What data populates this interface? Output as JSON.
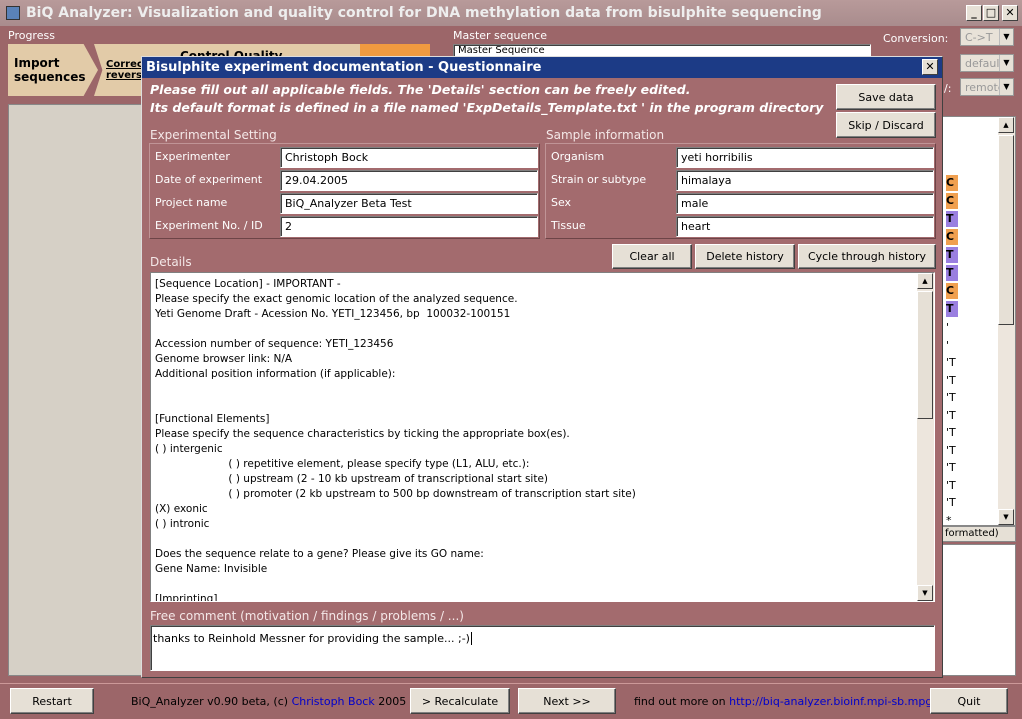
{
  "window": {
    "title": "BiQ Analyzer: Visualization and quality control for DNA methylation data from bisulphite sequencing"
  },
  "top": {
    "progress_label": "Progress",
    "steps": [
      "Import sequences",
      "Correct reverse",
      "Control Quality"
    ],
    "master_sequence_label": "Master sequence",
    "master_sequence_value": "Master Sequence",
    "conversion_label": "Conversion:",
    "conversion_value": "C->T",
    "option2_value": "default",
    "option3_label": "/:",
    "option3_value": "remote",
    "formatted_label": "formatted)"
  },
  "dialog": {
    "title": "Bisulphite experiment documentation - Questionnaire",
    "info_line1": "Please fill out all applicable fields. The 'Details' section can be freely edited.",
    "info_line2": "Its default format is defined in a file named 'ExpDetails_Template.txt ' in the program directory",
    "save_label": "Save data",
    "skip_label": "Skip / Discard",
    "experimental_setting": {
      "title": "Experimental Setting",
      "rows": [
        {
          "label": "Experimenter",
          "value": "Christoph Bock"
        },
        {
          "label": "Date of experiment",
          "value": "29.04.2005"
        },
        {
          "label": "Project name",
          "value": "BiQ_Analyzer Beta Test"
        },
        {
          "label": "Experiment No. / ID",
          "value": "2"
        }
      ]
    },
    "sample_information": {
      "title": "Sample information",
      "rows": [
        {
          "label": "Organism",
          "value": "yeti horribilis"
        },
        {
          "label": "Strain or subtype",
          "value": "himalaya"
        },
        {
          "label": "Sex",
          "value": "male"
        },
        {
          "label": "Tissue",
          "value": "heart"
        }
      ]
    },
    "details_label": "Details",
    "clear_all_label": "Clear all",
    "delete_history_label": "Delete history",
    "cycle_history_label": "Cycle through history",
    "details_text": "[Sequence Location] - IMPORTANT -\nPlease specify the exact genomic location of the analyzed sequence.\nYeti Genome Draft - Acession No. YETI_123456, bp  100032-100151\n\nAccession number of sequence: YETI_123456\nGenome browser link: N/A\nAdditional position information (if applicable):\n\n\n[Functional Elements]\nPlease specify the sequence characteristics by ticking the appropriate box(es).\n( ) intergenic\n                      ( ) repetitive element, please specify type (L1, ALU, etc.):\n                      ( ) upstream (2 - 10 kb upstream of transcriptional start site)\n                      ( ) promoter (2 kb upstream to 500 bp downstream of transcription start site)\n(X) exonic\n( ) intronic\n\nDoes the sequence relate to a gene? Please give its GO name:\nGene Name: Invisible\n\n[Imprinting]",
    "free_comment_label": "Free comment (motivation / findings / problems / ...)",
    "free_comment_value": "thanks to Reinhold Messner for providing the sample... ;-)"
  },
  "background_list": {
    "colored": [
      {
        "char": "C",
        "color": "#f0a050"
      },
      {
        "char": "C",
        "color": "#f0a050"
      },
      {
        "char": "T",
        "color": "#9a7fe0"
      },
      {
        "char": "C",
        "color": "#f0a050"
      },
      {
        "char": "T",
        "color": "#9a7fe0"
      },
      {
        "char": "T",
        "color": "#9a7fe0"
      },
      {
        "char": "C",
        "color": "#f0a050"
      },
      {
        "char": "T",
        "color": "#9a7fe0"
      }
    ],
    "plain": [
      "'",
      "'",
      "'T",
      "'T",
      "'T",
      "'T",
      "'T",
      "'T",
      "'T",
      "'T",
      "'T",
      "*"
    ]
  },
  "statusbar": {
    "restart_label": "Restart",
    "version_text": "BiQ_Analyzer v0.90 beta, (c) ",
    "author": "Christoph Bock",
    "year": " 2005",
    "recalculate_label": "> Recalculate",
    "next_label": "Next >>",
    "find_out_text": "find out more on ",
    "url": "http://biq-analyzer.bioinf.mpi-sb.mpg.de/",
    "quit_label": "Quit"
  }
}
